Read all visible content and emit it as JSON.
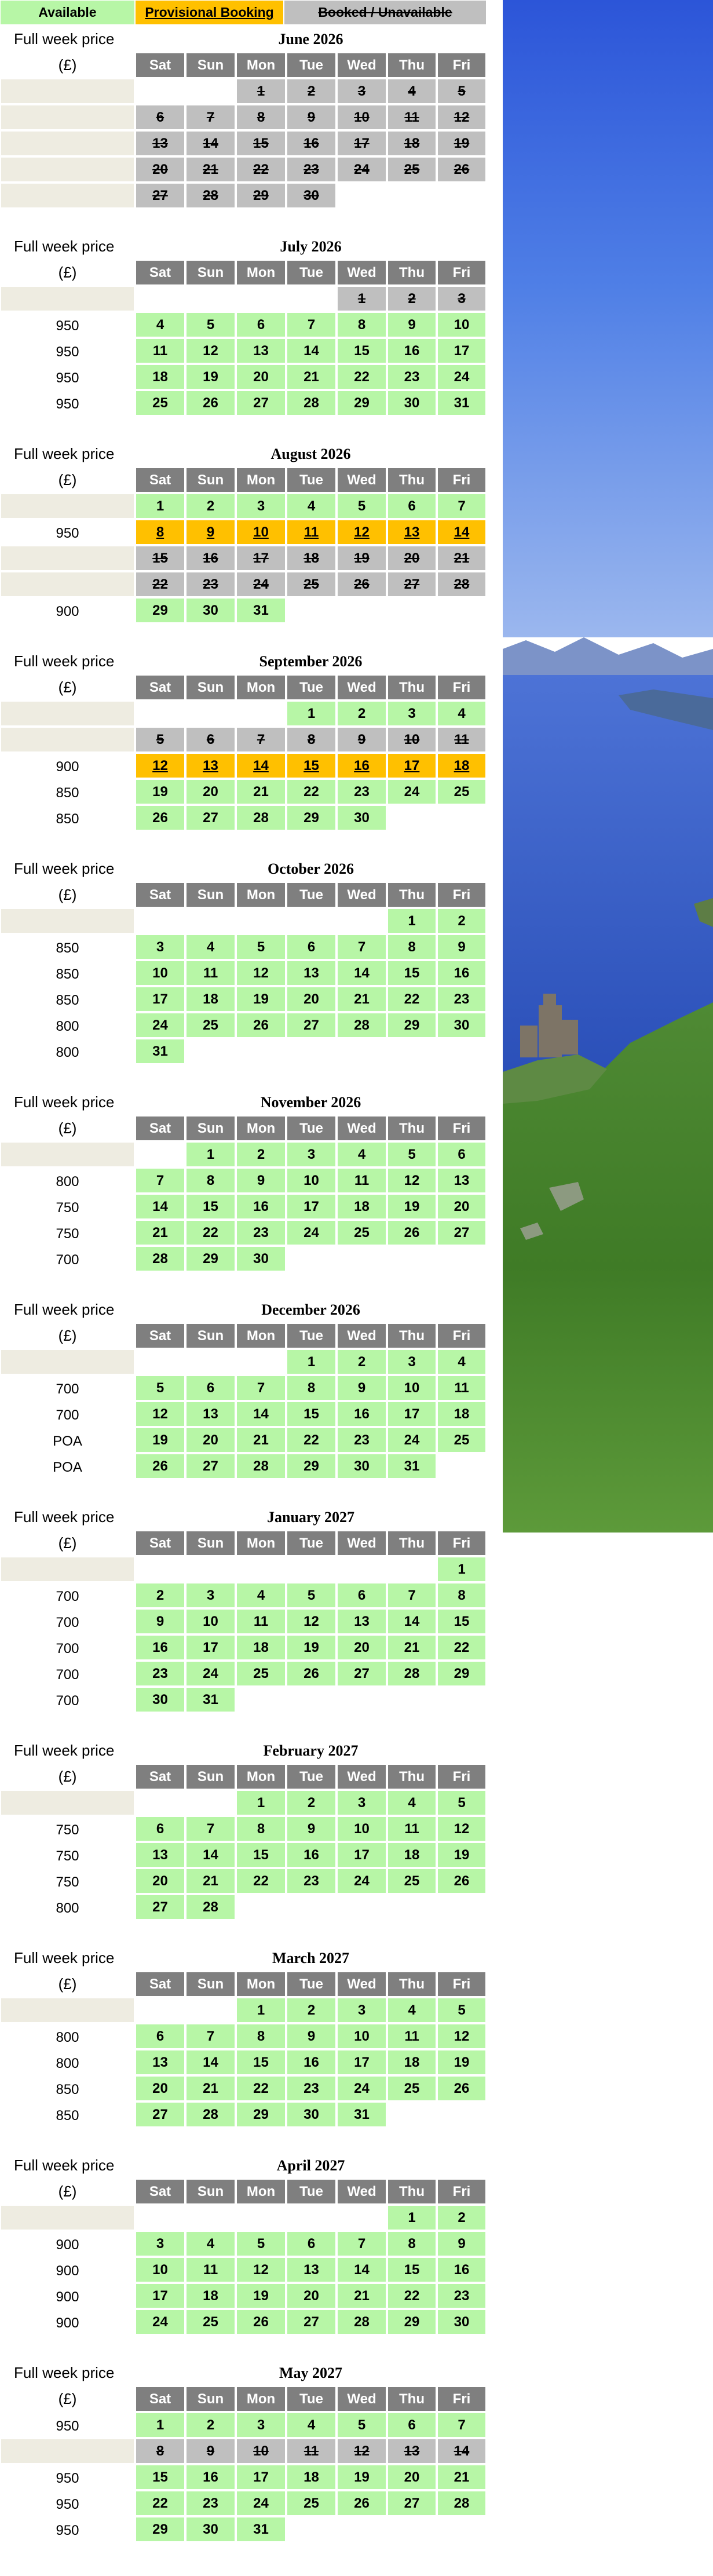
{
  "legend": {
    "available": "Available",
    "provisional": "Provisional Booking",
    "booked": "Booked / Unavailable"
  },
  "labels": {
    "full_week_price": "Full week price",
    "currency": "(£)"
  },
  "day_headers": [
    "Sat",
    "Sun",
    "Mon",
    "Tue",
    "Wed",
    "Thu",
    "Fri"
  ],
  "status_colors": {
    "available": "#b7f6a6",
    "provisional": "#ffc000",
    "booked": "#bfbfbf",
    "header": "#7f7f7f"
  },
  "months": [
    {
      "title": "June 2026",
      "rows": [
        {
          "price": "",
          "cells": [
            "",
            "",
            "b1",
            "b2",
            "b3",
            "b4",
            "b5"
          ]
        },
        {
          "price": "",
          "cells": [
            "b6",
            "b7",
            "b8",
            "b9",
            "b10",
            "b11",
            "b12"
          ]
        },
        {
          "price": "",
          "cells": [
            "b13",
            "b14",
            "b15",
            "b16",
            "b17",
            "b18",
            "b19"
          ]
        },
        {
          "price": "",
          "cells": [
            "b20",
            "b21",
            "b22",
            "b23",
            "b24",
            "b25",
            "b26"
          ]
        },
        {
          "price": "",
          "cells": [
            "b27",
            "b28",
            "b29",
            "b30",
            "",
            "",
            ""
          ]
        }
      ]
    },
    {
      "title": "July 2026",
      "rows": [
        {
          "price": "",
          "cells": [
            "",
            "",
            "",
            "",
            "b1",
            "b2",
            "b3"
          ]
        },
        {
          "price": "950",
          "cells": [
            "a4",
            "a5",
            "a6",
            "a7",
            "a8",
            "a9",
            "a10"
          ]
        },
        {
          "price": "950",
          "cells": [
            "a11",
            "a12",
            "a13",
            "a14",
            "a15",
            "a16",
            "a17"
          ]
        },
        {
          "price": "950",
          "cells": [
            "a18",
            "a19",
            "a20",
            "a21",
            "a22",
            "a23",
            "a24"
          ]
        },
        {
          "price": "950",
          "cells": [
            "a25",
            "a26",
            "a27",
            "a28",
            "a29",
            "a30",
            "a31"
          ]
        }
      ]
    },
    {
      "title": "August 2026",
      "rows": [
        {
          "price": "",
          "cells": [
            "a1",
            "a2",
            "a3",
            "a4",
            "a5",
            "a6",
            "a7"
          ]
        },
        {
          "price": "950",
          "cells": [
            "p8",
            "p9",
            "p10",
            "p11",
            "p12",
            "p13",
            "p14"
          ]
        },
        {
          "price": "",
          "cells": [
            "b15",
            "b16",
            "b17",
            "b18",
            "b19",
            "b20",
            "b21"
          ]
        },
        {
          "price": "",
          "cells": [
            "b22",
            "b23",
            "b24",
            "b25",
            "b26",
            "b27",
            "b28"
          ]
        },
        {
          "price": "900",
          "cells": [
            "a29",
            "a30",
            "a31",
            "",
            "",
            "",
            ""
          ]
        }
      ]
    },
    {
      "title": "September 2026",
      "rows": [
        {
          "price": "",
          "cells": [
            "",
            "",
            "",
            "a1",
            "a2",
            "a3",
            "a4"
          ]
        },
        {
          "price": "",
          "cells": [
            "b5",
            "b6",
            "b7",
            "b8",
            "b9",
            "b10",
            "b11"
          ]
        },
        {
          "price": "900",
          "cells": [
            "p12",
            "p13",
            "p14",
            "p15",
            "p16",
            "p17",
            "p18"
          ]
        },
        {
          "price": "850",
          "cells": [
            "a19",
            "a20",
            "a21",
            "a22",
            "a23",
            "a24",
            "a25"
          ]
        },
        {
          "price": "850",
          "cells": [
            "a26",
            "a27",
            "a28",
            "a29",
            "a30",
            "",
            ""
          ]
        }
      ]
    },
    {
      "title": "October 2026",
      "rows": [
        {
          "price": "",
          "cells": [
            "",
            "",
            "",
            "",
            "",
            "a1",
            "a2"
          ]
        },
        {
          "price": "850",
          "cells": [
            "a3",
            "a4",
            "a5",
            "a6",
            "a7",
            "a8",
            "a9"
          ]
        },
        {
          "price": "850",
          "cells": [
            "a10",
            "a11",
            "a12",
            "a13",
            "a14",
            "a15",
            "a16"
          ]
        },
        {
          "price": "850",
          "cells": [
            "a17",
            "a18",
            "a19",
            "a20",
            "a21",
            "a22",
            "a23"
          ]
        },
        {
          "price": "800",
          "cells": [
            "a24",
            "a25",
            "a26",
            "a27",
            "a28",
            "a29",
            "a30"
          ]
        },
        {
          "price": "800",
          "cells": [
            "a31",
            "",
            "",
            "",
            "",
            "",
            ""
          ]
        }
      ]
    },
    {
      "title": "November 2026",
      "rows": [
        {
          "price": "",
          "cells": [
            "",
            "a1",
            "a2",
            "a3",
            "a4",
            "a5",
            "a6"
          ]
        },
        {
          "price": "800",
          "cells": [
            "a7",
            "a8",
            "a9",
            "a10",
            "a11",
            "a12",
            "a13"
          ]
        },
        {
          "price": "750",
          "cells": [
            "a14",
            "a15",
            "a16",
            "a17",
            "a18",
            "a19",
            "a20"
          ]
        },
        {
          "price": "750",
          "cells": [
            "a21",
            "a22",
            "a23",
            "a24",
            "a25",
            "a26",
            "a27"
          ]
        },
        {
          "price": "700",
          "cells": [
            "a28",
            "a29",
            "a30",
            "",
            "",
            "",
            ""
          ]
        }
      ]
    },
    {
      "title": "December 2026",
      "rows": [
        {
          "price": "",
          "cells": [
            "",
            "",
            "",
            "a1",
            "a2",
            "a3",
            "a4"
          ]
        },
        {
          "price": "700",
          "cells": [
            "a5",
            "a6",
            "a7",
            "a8",
            "a9",
            "a10",
            "a11"
          ]
        },
        {
          "price": "700",
          "cells": [
            "a12",
            "a13",
            "a14",
            "a15",
            "a16",
            "a17",
            "a18"
          ]
        },
        {
          "price": "POA",
          "cells": [
            "a19",
            "a20",
            "a21",
            "a22",
            "a23",
            "a24",
            "a25"
          ]
        },
        {
          "price": "POA",
          "cells": [
            "a26",
            "a27",
            "a28",
            "a29",
            "a30",
            "a31",
            ""
          ]
        }
      ]
    },
    {
      "title": "January 2027",
      "rows": [
        {
          "price": "",
          "cells": [
            "",
            "",
            "",
            "",
            "",
            "",
            "a1"
          ]
        },
        {
          "price": "700",
          "cells": [
            "a2",
            "a3",
            "a4",
            "a5",
            "a6",
            "a7",
            "a8"
          ]
        },
        {
          "price": "700",
          "cells": [
            "a9",
            "a10",
            "a11",
            "a12",
            "a13",
            "a14",
            "a15"
          ]
        },
        {
          "price": "700",
          "cells": [
            "a16",
            "a17",
            "a18",
            "a19",
            "a20",
            "a21",
            "a22"
          ]
        },
        {
          "price": "700",
          "cells": [
            "a23",
            "a24",
            "a25",
            "a26",
            "a27",
            "a28",
            "a29"
          ]
        },
        {
          "price": "700",
          "cells": [
            "a30",
            "a31",
            "",
            "",
            "",
            "",
            ""
          ]
        }
      ]
    },
    {
      "title": "February 2027",
      "rows": [
        {
          "price": "",
          "cells": [
            "",
            "",
            "a1",
            "a2",
            "a3",
            "a4",
            "a5"
          ]
        },
        {
          "price": "750",
          "cells": [
            "a6",
            "a7",
            "a8",
            "a9",
            "a10",
            "a11",
            "a12"
          ]
        },
        {
          "price": "750",
          "cells": [
            "a13",
            "a14",
            "a15",
            "a16",
            "a17",
            "a18",
            "a19"
          ]
        },
        {
          "price": "750",
          "cells": [
            "a20",
            "a21",
            "a22",
            "a23",
            "a24",
            "a25",
            "a26"
          ]
        },
        {
          "price": "800",
          "cells": [
            "a27",
            "a28",
            "",
            "",
            "",
            "",
            ""
          ]
        }
      ]
    },
    {
      "title": "March 2027",
      "rows": [
        {
          "price": "",
          "cells": [
            "",
            "",
            "a1",
            "a2",
            "a3",
            "a4",
            "a5"
          ]
        },
        {
          "price": "800",
          "cells": [
            "a6",
            "a7",
            "a8",
            "a9",
            "a10",
            "a11",
            "a12"
          ]
        },
        {
          "price": "800",
          "cells": [
            "a13",
            "a14",
            "a15",
            "a16",
            "a17",
            "a18",
            "a19"
          ]
        },
        {
          "price": "850",
          "cells": [
            "a20",
            "a21",
            "a22",
            "a23",
            "a24",
            "a25",
            "a26"
          ]
        },
        {
          "price": "850",
          "cells": [
            "a27",
            "a28",
            "a29",
            "a30",
            "a31",
            "",
            ""
          ]
        }
      ]
    },
    {
      "title": "April 2027",
      "rows": [
        {
          "price": "",
          "cells": [
            "",
            "",
            "",
            "",
            "",
            "a1",
            "a2"
          ]
        },
        {
          "price": "900",
          "cells": [
            "a3",
            "a4",
            "a5",
            "a6",
            "a7",
            "a8",
            "a9"
          ]
        },
        {
          "price": "900",
          "cells": [
            "a10",
            "a11",
            "a12",
            "a13",
            "a14",
            "a15",
            "a16"
          ]
        },
        {
          "price": "900",
          "cells": [
            "a17",
            "a18",
            "a19",
            "a20",
            "a21",
            "a22",
            "a23"
          ]
        },
        {
          "price": "900",
          "cells": [
            "a24",
            "a25",
            "a26",
            "a27",
            "a28",
            "a29",
            "a30"
          ]
        }
      ]
    },
    {
      "title": "May 2027",
      "rows": [
        {
          "price": "950",
          "cells": [
            "a1",
            "a2",
            "a3",
            "a4",
            "a5",
            "a6",
            "a7"
          ]
        },
        {
          "price": "",
          "cells": [
            "b8",
            "b9",
            "b10",
            "b11",
            "b12",
            "b13",
            "b14"
          ]
        },
        {
          "price": "950",
          "cells": [
            "a15",
            "a16",
            "a17",
            "a18",
            "a19",
            "a20",
            "a21"
          ]
        },
        {
          "price": "950",
          "cells": [
            "a22",
            "a23",
            "a24",
            "a25",
            "a26",
            "a27",
            "a28"
          ]
        },
        {
          "price": "950",
          "cells": [
            "a29",
            "a30",
            "a31",
            "",
            "",
            "",
            ""
          ]
        }
      ]
    }
  ]
}
